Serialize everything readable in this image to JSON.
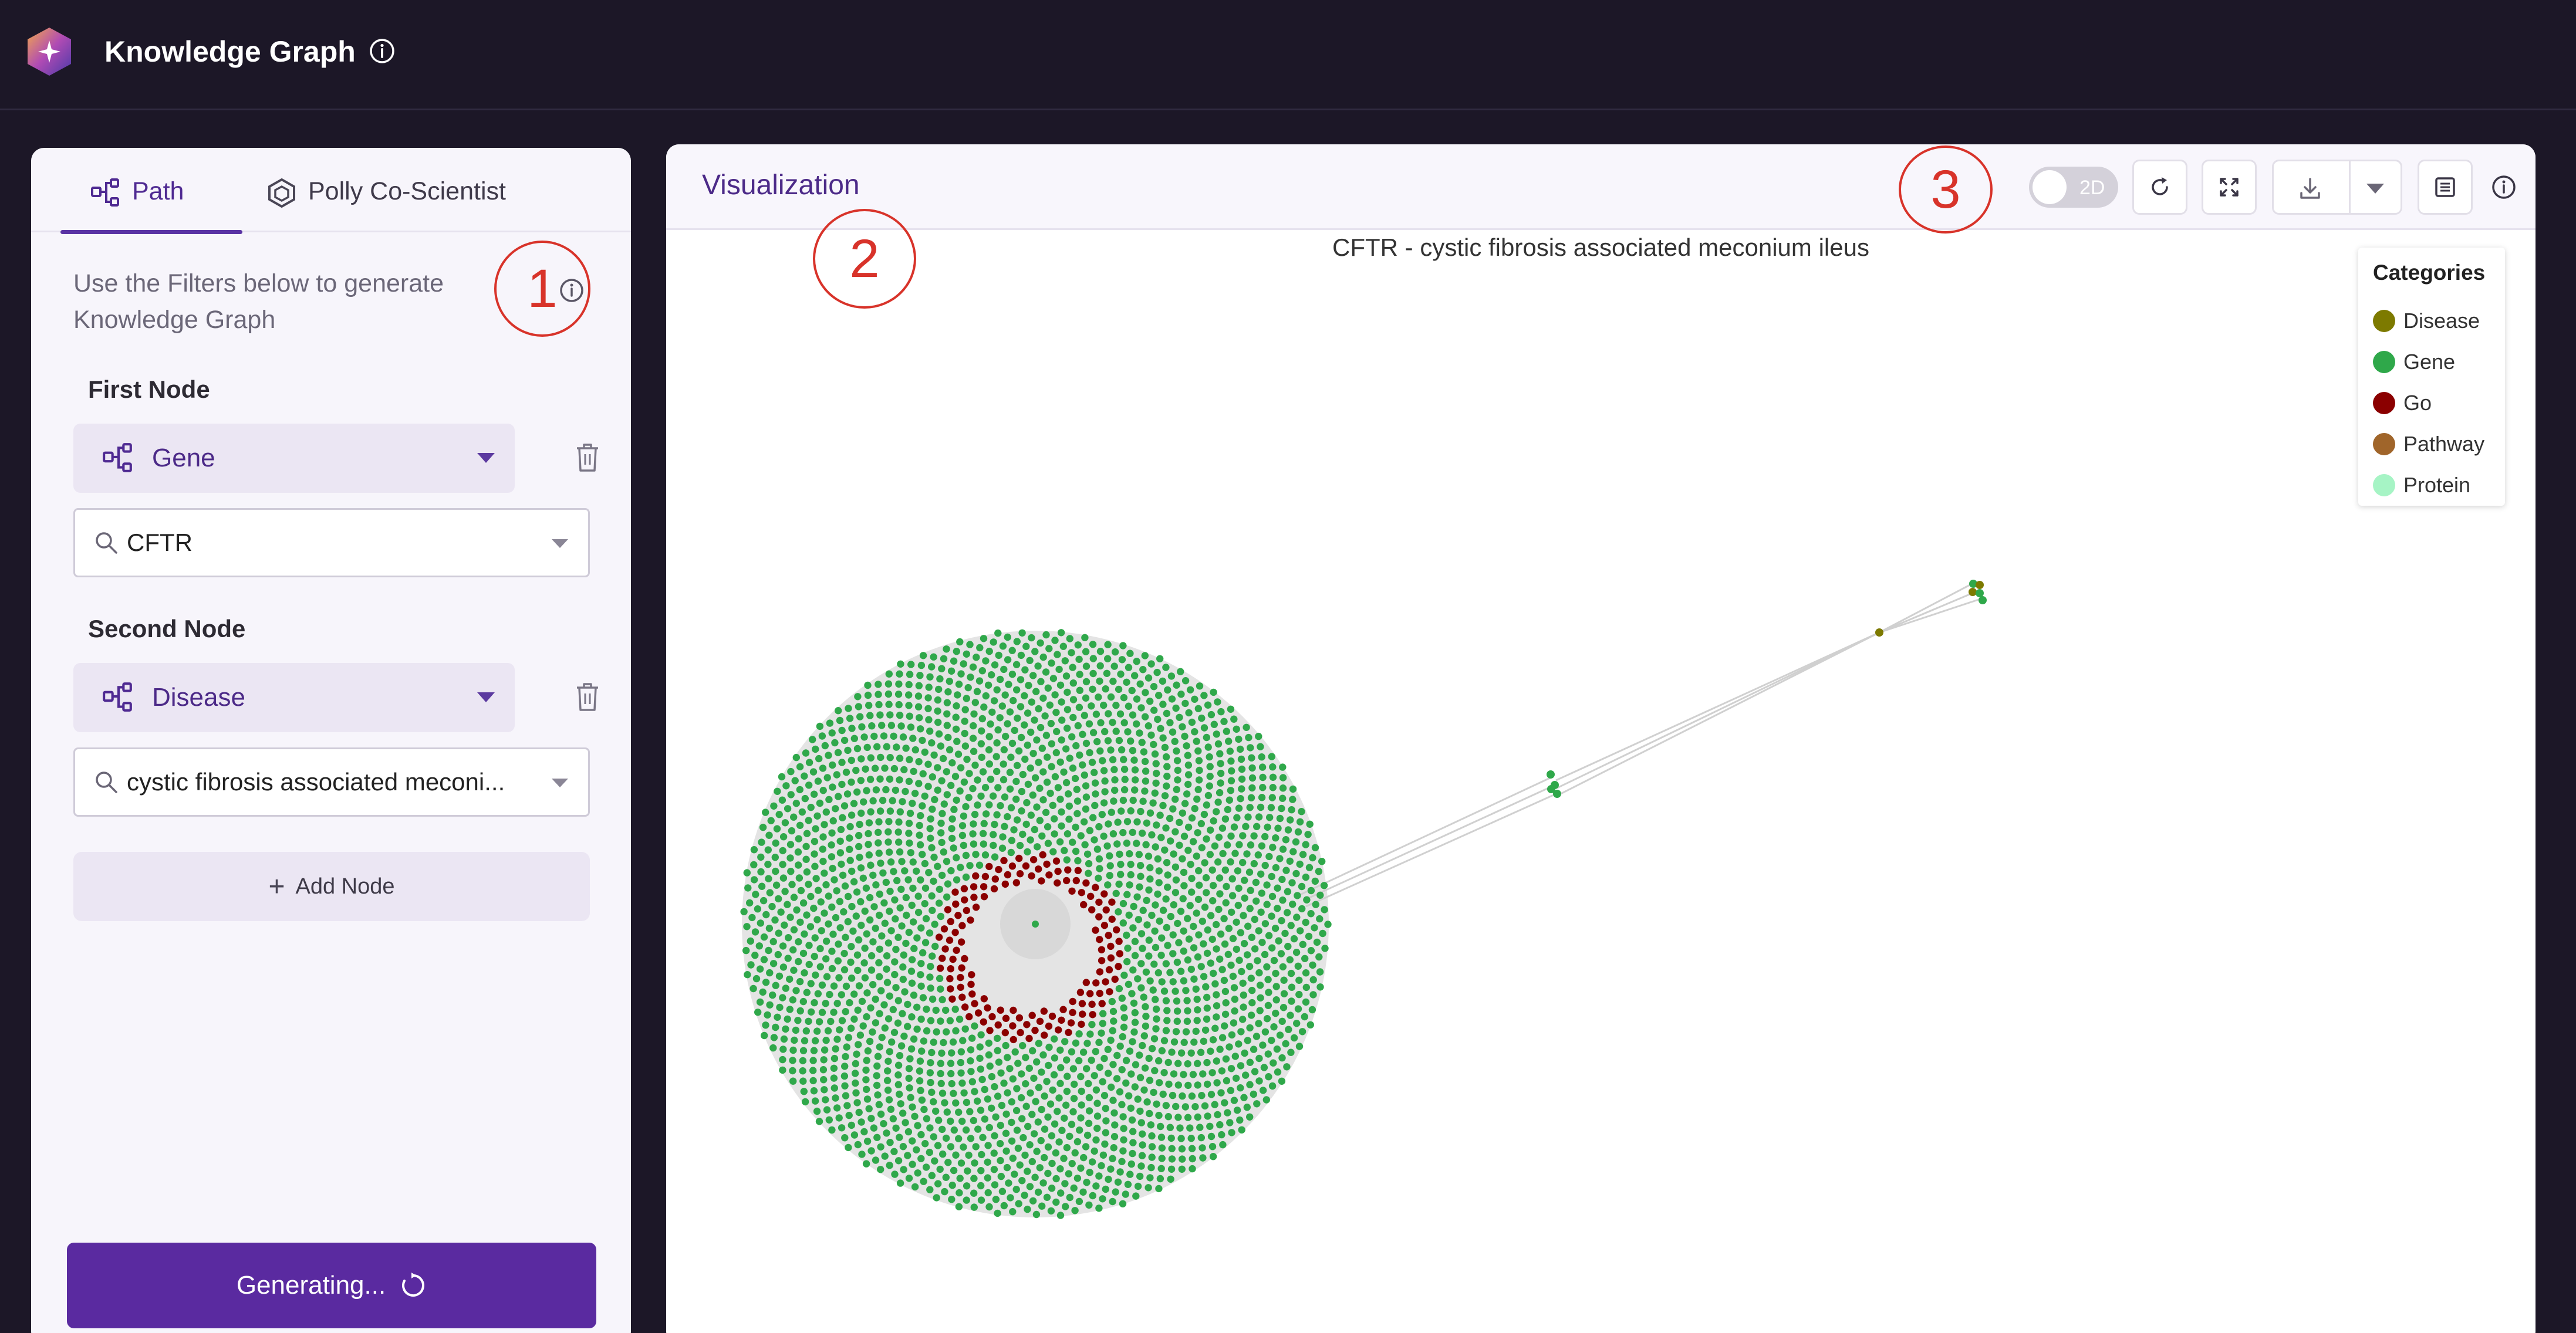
{
  "header": {
    "title": "Knowledge Graph"
  },
  "left_panel": {
    "tabs": [
      {
        "label": "Path",
        "active": true
      },
      {
        "label": "Polly Co-Scientist",
        "active": false
      }
    ],
    "description": "Use the Filters below to generate Knowledge Graph",
    "first_node": {
      "label": "First Node",
      "category": "Gene",
      "search_value": "CFTR"
    },
    "second_node": {
      "label": "Second Node",
      "category": "Disease",
      "search_value": "cystic fibrosis associated meconi..."
    },
    "add_node_label": "Add Node",
    "generate_label": "Generating..."
  },
  "visualization": {
    "title": "Visualization",
    "toggle_label": "2D",
    "graph_title": "CFTR - cystic fibrosis associated meconium ileus",
    "legend": {
      "title": "Categories",
      "items": [
        {
          "label": "Disease",
          "color": "#7d7a00"
        },
        {
          "label": "Gene",
          "color": "#2fa84a"
        },
        {
          "label": "Go",
          "color": "#8b0000"
        },
        {
          "label": "Pathway",
          "color": "#a0652a"
        },
        {
          "label": "Protein",
          "color": "#a6f4c5"
        }
      ]
    }
  },
  "annotations": [
    "1",
    "2",
    "3"
  ]
}
